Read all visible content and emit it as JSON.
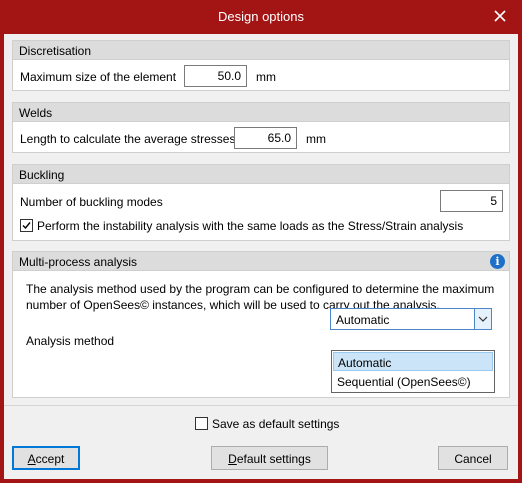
{
  "window": {
    "title": "Design options",
    "close_icon": "close-icon"
  },
  "discretisation": {
    "header": "Discretisation",
    "max_size_label": "Maximum size of the element",
    "max_size_value": "50.0",
    "unit": "mm"
  },
  "welds": {
    "header": "Welds",
    "length_label": "Length to calculate the average stresses",
    "length_value": "65.0",
    "unit": "mm"
  },
  "buckling": {
    "header": "Buckling",
    "modes_label": "Number of buckling modes",
    "modes_value": "5",
    "same_loads_label": "Perform the instability analysis with the same loads as the Stress/Strain analysis",
    "same_loads_checked": true
  },
  "multiprocess": {
    "header": "Multi-process analysis",
    "description_line1": "The analysis method used by the program can be configured to determine the maximum",
    "description_line2": "number of OpenSees© instances, which will be used to carry out the analysis.",
    "method_label": "Analysis method",
    "method_value": "Automatic",
    "options": [
      "Automatic",
      "Sequential (OpenSees©)"
    ],
    "info_icon": "info-icon"
  },
  "footer": {
    "save_default_label": "Save as default settings",
    "save_default_checked": false,
    "accept_first": "A",
    "accept_rest": "ccept",
    "default_first": "D",
    "default_rest": "efault settings",
    "cancel_label": "Cancel"
  },
  "colors": {
    "titlebar": "#a31515",
    "group_header": "#dcdcdc",
    "selection": "#cce4f7",
    "accent": "#0078d7"
  }
}
